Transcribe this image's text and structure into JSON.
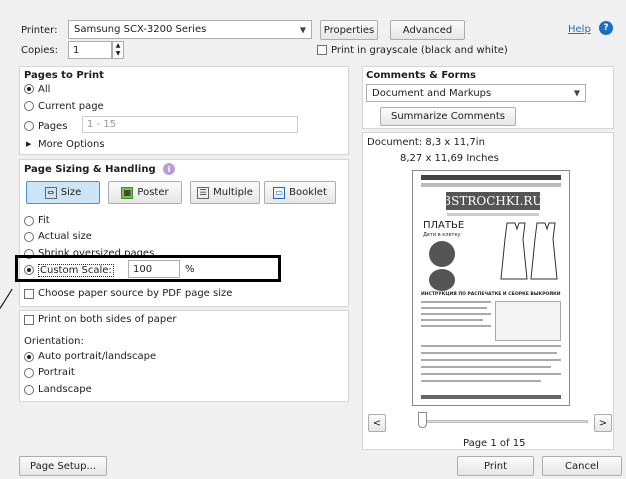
{
  "printer": {
    "label": "Printer:",
    "value": "Samsung SCX-3200 Series",
    "properties": "Properties",
    "advanced": "Advanced",
    "help": "Help"
  },
  "copies": {
    "label": "Copies:",
    "value": "1"
  },
  "grayscale": {
    "label": "Print in grayscale (black and white)",
    "checked": false
  },
  "pages_to_print": {
    "heading": "Pages to Print",
    "options": [
      "All",
      "Current page",
      "Pages"
    ],
    "selected": "All",
    "pages_value": "1 - 15",
    "more_options": "More Options"
  },
  "sizing": {
    "heading": "Page Sizing & Handling",
    "buttons": [
      "Size",
      "Poster",
      "Multiple",
      "Booklet"
    ],
    "active": "Size",
    "options": [
      "Fit",
      "Actual size",
      "Shrink oversized pages",
      "Custom Scale:"
    ],
    "selected": "Custom Scale:",
    "scale_value": "100",
    "scale_unit": "%",
    "paper_source": "Choose paper source by PDF page size"
  },
  "both_sides": "Print on both sides of paper",
  "orientation": {
    "label": "Orientation:",
    "options": [
      "Auto portrait/landscape",
      "Portrait",
      "Landscape"
    ],
    "selected": "Auto portrait/landscape"
  },
  "comments": {
    "heading": "Comments & Forms",
    "value": "Document and Markups",
    "summarize": "Summarize Comments"
  },
  "document": {
    "size_label": "Document: 8,3 x 11,7in",
    "preview_size": "8,27 x 11,69 Inches"
  },
  "preview": {
    "logo": "3STROCHKI.RU",
    "title": "ПЛАТЬЕ",
    "subtitle": "Дети в клетку",
    "section": "ИНСТРУКЦИЯ ПО РАСПЕЧАТКЕ И СБОРКЕ ВЫКРОЙКИ"
  },
  "nav": {
    "prev": "<",
    "next": ">",
    "page_label": "Page 1 of 15",
    "slider_fraction": 0.0
  },
  "footer": {
    "page_setup": "Page Setup...",
    "print": "Print",
    "cancel": "Cancel"
  },
  "colors": {
    "accent": "#1a6fc4",
    "highlight_box": "#000000",
    "link": "#1a6fc4"
  }
}
